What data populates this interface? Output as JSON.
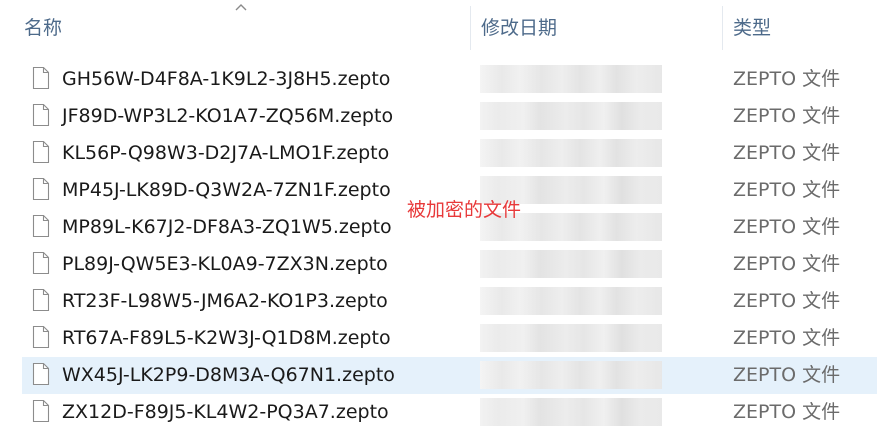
{
  "columns": {
    "name": "名称",
    "modified": "修改日期",
    "type": "类型"
  },
  "annotation": "被加密的文件",
  "files": [
    {
      "name": "GH56W-D4F8A-1K9L2-3J8H5.zepto",
      "type": "ZEPTO 文件",
      "selected": false
    },
    {
      "name": "JF89D-WP3L2-KO1A7-ZQ56M.zepto",
      "type": "ZEPTO 文件",
      "selected": false
    },
    {
      "name": "KL56P-Q98W3-D2J7A-LMO1F.zepto",
      "type": "ZEPTO 文件",
      "selected": false
    },
    {
      "name": "MP45J-LK89D-Q3W2A-7ZN1F.zepto",
      "type": "ZEPTO 文件",
      "selected": false
    },
    {
      "name": "MP89L-K67J2-DF8A3-ZQ1W5.zepto",
      "type": "ZEPTO 文件",
      "selected": false
    },
    {
      "name": "PL89J-QW5E3-KL0A9-7ZX3N.zepto",
      "type": "ZEPTO 文件",
      "selected": false
    },
    {
      "name": "RT23F-L98W5-JM6A2-KO1P3.zepto",
      "type": "ZEPTO 文件",
      "selected": false
    },
    {
      "name": "RT67A-F89L5-K2W3J-Q1D8M.zepto",
      "type": "ZEPTO 文件",
      "selected": false
    },
    {
      "name": "WX45J-LK2P9-D8M3A-Q67N1.zepto",
      "type": "ZEPTO 文件",
      "selected": true
    },
    {
      "name": "ZX12D-F89J5-KL4W2-PQ3A7.zepto",
      "type": "ZEPTO 文件",
      "selected": false
    }
  ],
  "colors": {
    "header_text": "#4d6a8a",
    "selection": "#e5f1fb",
    "annotation": "#e8393a"
  },
  "icons": {
    "sort": "sort-ascending-icon",
    "file": "file-icon"
  }
}
